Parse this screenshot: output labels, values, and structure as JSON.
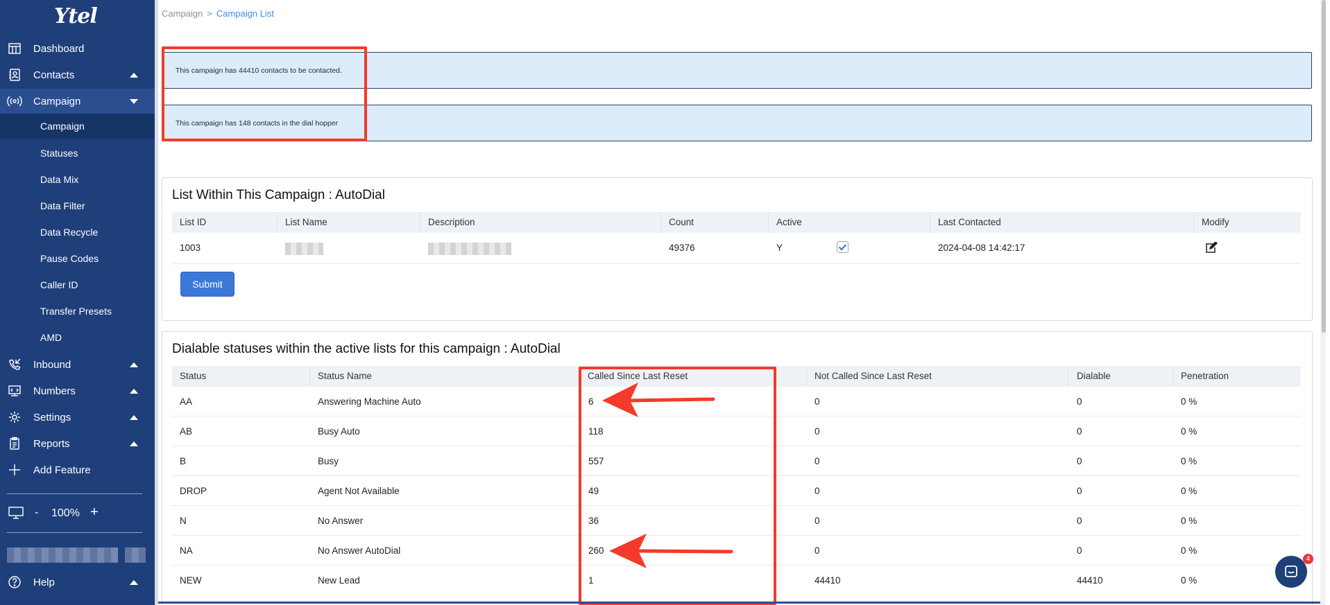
{
  "app": {
    "logo": "Ytel"
  },
  "sidebar": {
    "items": [
      {
        "label": "Dashboard",
        "icon": "dashboard-icon"
      },
      {
        "label": "Contacts",
        "icon": "contacts-icon"
      },
      {
        "label": "Campaign",
        "icon": "broadcast-icon"
      },
      {
        "label": "Inbound",
        "icon": "phone-incoming-icon"
      },
      {
        "label": "Numbers",
        "icon": "numbers-icon"
      },
      {
        "label": "Settings",
        "icon": "gear-icon"
      },
      {
        "label": "Reports",
        "icon": "report-icon"
      },
      {
        "label": "Add Feature",
        "icon": "plus-icon"
      }
    ],
    "campaign_subitems": [
      "Campaign",
      "Statuses",
      "Data Mix",
      "Data Filter",
      "Data Recycle",
      "Pause Codes",
      "Caller ID",
      "Transfer Presets",
      "AMD"
    ],
    "zoom": {
      "minus": "-",
      "value": "100%",
      "plus": "+"
    },
    "help_label": "Help"
  },
  "breadcrumb": {
    "root": "Campaign",
    "separator": ">",
    "current": "Campaign List"
  },
  "alerts": [
    "This campaign has 44410 contacts to be contacted.",
    "This campaign has 148 contacts in the dial hopper"
  ],
  "lists_panel": {
    "title": "List Within This Campaign : AutoDial",
    "headers": [
      "List ID",
      "List Name",
      "Description",
      "Count",
      "Active",
      "Last Contacted",
      "Modify"
    ],
    "rows": [
      {
        "list_id": "1003",
        "count": "49376",
        "active": "Y",
        "checked": true,
        "last_contacted": "2024-04-08 14:42:17"
      }
    ],
    "submit_label": "Submit"
  },
  "statuses_panel": {
    "title": "Dialable statuses within the active lists for this campaign : AutoDial",
    "headers": [
      "Status",
      "Status Name",
      "Called Since Last Reset",
      "Not Called Since Last Reset",
      "Dialable",
      "Penetration"
    ],
    "rows": [
      {
        "status": "AA",
        "name": "Answering Machine Auto",
        "called": "6",
        "not_called": "0",
        "dialable": "0",
        "penetration": "0 %"
      },
      {
        "status": "AB",
        "name": "Busy Auto",
        "called": "118",
        "not_called": "0",
        "dialable": "0",
        "penetration": "0 %"
      },
      {
        "status": "B",
        "name": "Busy",
        "called": "557",
        "not_called": "0",
        "dialable": "0",
        "penetration": "0 %"
      },
      {
        "status": "DROP",
        "name": "Agent Not Available",
        "called": "49",
        "not_called": "0",
        "dialable": "0",
        "penetration": "0 %"
      },
      {
        "status": "N",
        "name": "No Answer",
        "called": "36",
        "not_called": "0",
        "dialable": "0",
        "penetration": "0 %"
      },
      {
        "status": "NA",
        "name": "No Answer AutoDial",
        "called": "260",
        "not_called": "0",
        "dialable": "0",
        "penetration": "0 %"
      },
      {
        "status": "NEW",
        "name": "New Lead",
        "called": "1",
        "not_called": "44410",
        "dialable": "44410",
        "penetration": "0 %"
      }
    ]
  },
  "chat": {
    "badge_count": "4"
  },
  "colors": {
    "sidebar": "#1f3f7a",
    "accent": "#3c78d8",
    "annotation": "#f43a2a",
    "alert_bg": "#dcecfb"
  }
}
